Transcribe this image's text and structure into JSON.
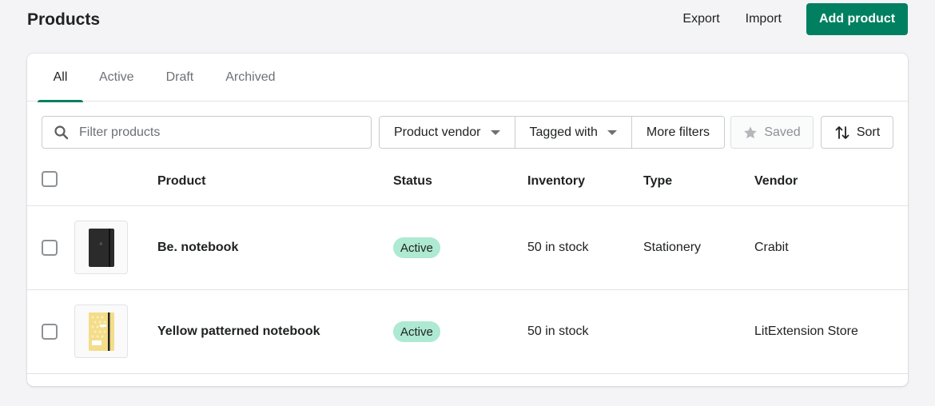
{
  "header": {
    "title": "Products",
    "export_label": "Export",
    "import_label": "Import",
    "add_label": "Add product"
  },
  "tabs": [
    {
      "label": "All",
      "active": true
    },
    {
      "label": "Active",
      "active": false
    },
    {
      "label": "Draft",
      "active": false
    },
    {
      "label": "Archived",
      "active": false
    }
  ],
  "filters": {
    "search_placeholder": "Filter products",
    "search_value": "",
    "product_vendor": "Product vendor",
    "tagged_with": "Tagged with",
    "more_filters": "More filters",
    "saved": "Saved",
    "sort": "Sort"
  },
  "table": {
    "columns": [
      "Product",
      "Status",
      "Inventory",
      "Type",
      "Vendor"
    ],
    "rows": [
      {
        "thumbnail": "black-notebook",
        "product": "Be. notebook",
        "status": "Active",
        "inventory": "50 in stock",
        "type": "Stationery",
        "vendor": "Crabit"
      },
      {
        "thumbnail": "yellow-patterned-notebook",
        "product": "Yellow patterned notebook",
        "status": "Active",
        "inventory": "50 in stock",
        "type": "",
        "vendor": "LitExtension Store"
      }
    ]
  },
  "colors": {
    "primary": "#008060",
    "badge_active": "#aee9d1",
    "background": "#f4f4f6"
  }
}
